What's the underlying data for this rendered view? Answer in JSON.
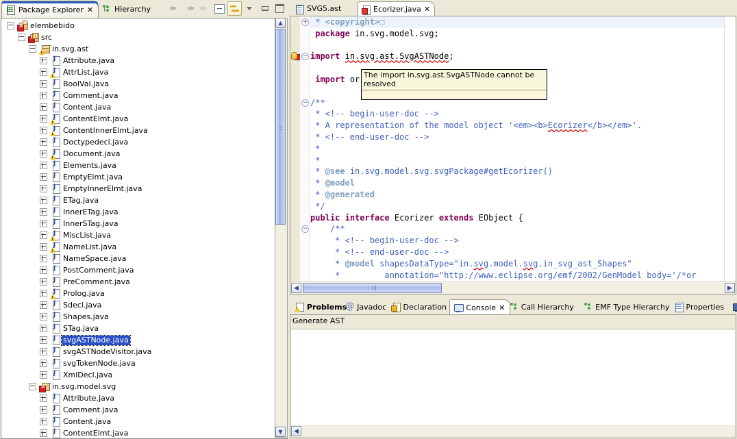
{
  "left_view": {
    "tabs": [
      {
        "label": "Package Explorer",
        "icon": "package-explorer-icon",
        "active": true,
        "closeable": true
      },
      {
        "label": "Hierarchy",
        "icon": "hierarchy-icon",
        "active": false,
        "closeable": false
      }
    ],
    "toolbar": [
      {
        "name": "back-button",
        "icon": "back-arrow-icon",
        "enabled": false
      },
      {
        "name": "forward-button",
        "icon": "forward-arrow-icon",
        "enabled": false
      },
      {
        "name": "up-button",
        "icon": "up-arrow-icon",
        "enabled": false
      },
      {
        "name": "collapse-all-button",
        "icon": "collapse-all-icon",
        "enabled": true
      },
      {
        "name": "link-with-editor-toggle",
        "icon": "link-editor-icon",
        "enabled": true,
        "pressed": true
      },
      {
        "name": "view-menu-button",
        "icon": "chevron-down-icon",
        "enabled": true
      },
      {
        "name": "minimize-button",
        "icon": "minimize-icon",
        "enabled": true
      },
      {
        "name": "maximize-button",
        "icon": "maximize-icon",
        "enabled": true
      }
    ],
    "tree": [
      {
        "label": "elembebido",
        "depth": 0,
        "icon": "project-icon",
        "badge": "error",
        "expander": "minus"
      },
      {
        "label": "src",
        "depth": 1,
        "icon": "source-folder-icon",
        "badge": "error",
        "expander": "minus"
      },
      {
        "label": "in.svg.ast",
        "depth": 2,
        "icon": "package-icon",
        "badge": "warning",
        "expander": "minus"
      },
      {
        "label": "Attribute.java",
        "depth": 3,
        "icon": "java-file-icon",
        "badge": "none",
        "expander": "plus"
      },
      {
        "label": "AttrList.java",
        "depth": 3,
        "icon": "java-file-icon",
        "badge": "warning",
        "expander": "plus"
      },
      {
        "label": "BoolVal.java",
        "depth": 3,
        "icon": "java-file-icon",
        "badge": "none",
        "expander": "plus"
      },
      {
        "label": "Comment.java",
        "depth": 3,
        "icon": "java-file-icon",
        "badge": "none",
        "expander": "plus"
      },
      {
        "label": "Content.java",
        "depth": 3,
        "icon": "java-file-icon",
        "badge": "none",
        "expander": "plus"
      },
      {
        "label": "ContentElmt.java",
        "depth": 3,
        "icon": "java-file-icon",
        "badge": "warning",
        "expander": "plus"
      },
      {
        "label": "ContentInnerElmt.java",
        "depth": 3,
        "icon": "java-file-icon",
        "badge": "warning",
        "expander": "plus"
      },
      {
        "label": "Doctypedecl.java",
        "depth": 3,
        "icon": "java-file-icon",
        "badge": "none",
        "expander": "plus"
      },
      {
        "label": "Document.java",
        "depth": 3,
        "icon": "java-file-icon",
        "badge": "warning",
        "expander": "plus"
      },
      {
        "label": "Elements.java",
        "depth": 3,
        "icon": "java-file-icon",
        "badge": "none",
        "expander": "plus"
      },
      {
        "label": "EmptyElmt.java",
        "depth": 3,
        "icon": "java-file-icon",
        "badge": "none",
        "expander": "plus"
      },
      {
        "label": "EmptyInnerElmt.java",
        "depth": 3,
        "icon": "java-file-icon",
        "badge": "none",
        "expander": "plus"
      },
      {
        "label": "ETag.java",
        "depth": 3,
        "icon": "java-file-icon",
        "badge": "none",
        "expander": "plus"
      },
      {
        "label": "InnerETag.java",
        "depth": 3,
        "icon": "java-file-icon",
        "badge": "none",
        "expander": "plus"
      },
      {
        "label": "InnerSTag.java",
        "depth": 3,
        "icon": "java-file-icon",
        "badge": "none",
        "expander": "plus"
      },
      {
        "label": "MiscList.java",
        "depth": 3,
        "icon": "java-file-icon",
        "badge": "warning",
        "expander": "plus"
      },
      {
        "label": "NameList.java",
        "depth": 3,
        "icon": "java-file-icon",
        "badge": "warning",
        "expander": "plus"
      },
      {
        "label": "NameSpace.java",
        "depth": 3,
        "icon": "java-file-icon",
        "badge": "none",
        "expander": "plus"
      },
      {
        "label": "PostComment.java",
        "depth": 3,
        "icon": "java-file-icon",
        "badge": "none",
        "expander": "plus"
      },
      {
        "label": "PreComment.java",
        "depth": 3,
        "icon": "java-file-icon",
        "badge": "none",
        "expander": "plus"
      },
      {
        "label": "Prolog.java",
        "depth": 3,
        "icon": "java-file-icon",
        "badge": "warning",
        "expander": "plus"
      },
      {
        "label": "Sdecl.java",
        "depth": 3,
        "icon": "java-file-icon",
        "badge": "none",
        "expander": "plus"
      },
      {
        "label": "Shapes.java",
        "depth": 3,
        "icon": "java-file-icon",
        "badge": "none",
        "expander": "plus"
      },
      {
        "label": "STag.java",
        "depth": 3,
        "icon": "java-file-icon",
        "badge": "none",
        "expander": "plus"
      },
      {
        "label": "svgASTNode.java",
        "depth": 3,
        "icon": "java-file-icon",
        "badge": "none",
        "expander": "plus",
        "selected": true
      },
      {
        "label": "svgASTNodeVisitor.java",
        "depth": 3,
        "icon": "java-file-icon",
        "badge": "none",
        "expander": "plus"
      },
      {
        "label": "svgTokenNode.java",
        "depth": 3,
        "icon": "java-file-icon",
        "badge": "none",
        "expander": "plus"
      },
      {
        "label": "XmlDecl.java",
        "depth": 3,
        "icon": "java-file-icon",
        "badge": "none",
        "expander": "plus"
      },
      {
        "label": "in.svg.model.svg",
        "depth": 2,
        "icon": "package-icon",
        "badge": "error",
        "expander": "minus"
      },
      {
        "label": "Attribute.java",
        "depth": 3,
        "icon": "java-file-icon",
        "badge": "none",
        "expander": "plus"
      },
      {
        "label": "Comment.java",
        "depth": 3,
        "icon": "java-file-icon",
        "badge": "none",
        "expander": "plus"
      },
      {
        "label": "Content.java",
        "depth": 3,
        "icon": "java-file-icon",
        "badge": "none",
        "expander": "plus"
      },
      {
        "label": "ContentElmt.java",
        "depth": 3,
        "icon": "java-file-icon",
        "badge": "none",
        "expander": "plus"
      }
    ]
  },
  "editor": {
    "tabs": [
      {
        "label": "SVG5.ast",
        "icon": "ast-file-icon",
        "active": false,
        "closeable": false
      },
      {
        "label": "Ecorizer.java",
        "icon": "java-file-error-icon",
        "active": true,
        "closeable": true
      }
    ],
    "tooltip": {
      "text": "The import in.svg.ast.SvgASTNode cannot be resolved"
    },
    "lines": [
      {
        "i": 0,
        "fold": "plus",
        "highlight": true,
        "tokens": [
          {
            "t": " * ",
            "c": "cmt"
          },
          {
            "t": "<copyright>",
            "c": "cmt"
          },
          {
            "t": "□",
            "c": "cmt"
          }
        ]
      },
      {
        "i": 1,
        "tokens": [
          {
            "t": " ",
            "c": ""
          },
          {
            "t": "package",
            "c": "kw"
          },
          {
            "t": " in.svg.model.svg;",
            "c": ""
          }
        ]
      },
      {
        "i": 2,
        "tokens": []
      },
      {
        "i": 3,
        "marker": "error",
        "fold": "minus",
        "tokens": [
          {
            "t": "",
            "c": ""
          },
          {
            "t": "import",
            "c": "kw"
          },
          {
            "t": " ",
            "c": ""
          },
          {
            "t": "in.svg.ast.SvgASTNode",
            "c": "und"
          },
          {
            "t": ";",
            "c": ""
          }
        ]
      },
      {
        "i": 4,
        "tokens": []
      },
      {
        "i": 5,
        "tokens": [
          {
            "t": " ",
            "c": ""
          },
          {
            "t": "import",
            "c": "kw"
          },
          {
            "t": " or",
            "c": ""
          }
        ]
      },
      {
        "i": 6,
        "tokens": []
      },
      {
        "i": 7,
        "fold": "minus",
        "tokens": [
          {
            "t": "/**",
            "c": "cmj"
          }
        ]
      },
      {
        "i": 8,
        "tokens": [
          {
            "t": " * ",
            "c": "cmj"
          },
          {
            "t": "<!-- begin-user-doc -->",
            "c": "cmj"
          }
        ]
      },
      {
        "i": 9,
        "tokens": [
          {
            "t": " * A representation of the model object '<em><b>",
            "c": "cmj"
          },
          {
            "t": "Ecorizer",
            "c": "cmj und"
          },
          {
            "t": "</b></em>'.",
            "c": "cmj"
          }
        ]
      },
      {
        "i": 10,
        "tokens": [
          {
            "t": " * ",
            "c": "cmj"
          },
          {
            "t": "<!-- end-user-doc -->",
            "c": "cmj"
          }
        ]
      },
      {
        "i": 11,
        "tokens": [
          {
            "t": " *",
            "c": "cmj"
          }
        ]
      },
      {
        "i": 12,
        "tokens": [
          {
            "t": " *",
            "c": "cmj"
          }
        ]
      },
      {
        "i": 13,
        "tokens": [
          {
            "t": " * ",
            "c": "cmj"
          },
          {
            "t": "@see",
            "c": "cmt"
          },
          {
            "t": " in.svg.model.svg.svgPackage#getEcorizer()",
            "c": "cmj"
          }
        ]
      },
      {
        "i": 14,
        "tokens": [
          {
            "t": " * ",
            "c": "cmj"
          },
          {
            "t": "@model",
            "c": "cmt"
          }
        ]
      },
      {
        "i": 15,
        "tokens": [
          {
            "t": " * ",
            "c": "cmj"
          },
          {
            "t": "@generated",
            "c": "cmt"
          }
        ]
      },
      {
        "i": 16,
        "tokens": [
          {
            "t": " */",
            "c": "cmj"
          }
        ]
      },
      {
        "i": 17,
        "tokens": [
          {
            "t": "",
            "c": ""
          },
          {
            "t": "public",
            "c": "kw"
          },
          {
            "t": " ",
            "c": ""
          },
          {
            "t": "interface",
            "c": "kw"
          },
          {
            "t": " Ecorizer ",
            "c": ""
          },
          {
            "t": "extends",
            "c": "kw"
          },
          {
            "t": " EObject {",
            "c": ""
          }
        ]
      },
      {
        "i": 18,
        "fold": "minus",
        "tokens": [
          {
            "t": "    /**",
            "c": "cmj"
          }
        ]
      },
      {
        "i": 19,
        "tokens": [
          {
            "t": "     * ",
            "c": "cmj"
          },
          {
            "t": "<!-- begin-user-doc -->",
            "c": "cmj"
          }
        ]
      },
      {
        "i": 20,
        "tokens": [
          {
            "t": "     * ",
            "c": "cmj"
          },
          {
            "t": "<!-- end-user-doc -->",
            "c": "cmj"
          }
        ]
      },
      {
        "i": 21,
        "tokens": [
          {
            "t": "     * ",
            "c": "cmj"
          },
          {
            "t": "@model",
            "c": "cmt"
          },
          {
            "t": " shapesDataType=\"in.",
            "c": "cmj"
          },
          {
            "t": "svg",
            "c": "cmj und"
          },
          {
            "t": ".model.",
            "c": "cmj"
          },
          {
            "t": "svg",
            "c": "cmj und"
          },
          {
            "t": ".in_svg_ast_Shapes\"",
            "c": "cmj"
          }
        ]
      },
      {
        "i": 22,
        "tokens": [
          {
            "t": "     *         annotation=\"http://www.eclipse.org/emf/2002/GenModel body='/*or",
            "c": "cmj"
          }
        ]
      }
    ]
  },
  "bottom_view": {
    "tabs": [
      {
        "label": "Problems",
        "icon": "problems-icon",
        "active": false,
        "bold": true,
        "closeable": false
      },
      {
        "label": "Javadoc",
        "icon": "javadoc-icon",
        "active": false,
        "bold": false,
        "closeable": false
      },
      {
        "label": "Declaration",
        "icon": "declaration-icon",
        "active": false,
        "bold": false,
        "closeable": false
      },
      {
        "label": "Console",
        "icon": "console-icon",
        "active": true,
        "bold": false,
        "closeable": true
      },
      {
        "label": "Call Hierarchy",
        "icon": "call-hierarchy-icon",
        "active": false,
        "bold": false,
        "closeable": false
      },
      {
        "label": "EMF Type Hierarchy",
        "icon": "emf-type-hierarchy-icon",
        "active": false,
        "bold": false,
        "closeable": false
      },
      {
        "label": "Properties",
        "icon": "properties-icon",
        "active": false,
        "bold": false,
        "closeable": false
      },
      {
        "label": "",
        "icon": "monitor-icon",
        "active": false,
        "bold": false,
        "closeable": false
      }
    ],
    "console_title": "Generate AST",
    "console_output": ""
  },
  "colors": {
    "chrome": "#ece9d8",
    "selection": "#2a50c8",
    "keyword": "#7f0055",
    "javadoc": "#3f5fbf",
    "javadoc_tag": "#7f9fbf",
    "error": "#cf2020",
    "warning": "#f3c21a",
    "tooltip_bg": "#faf8dc"
  }
}
